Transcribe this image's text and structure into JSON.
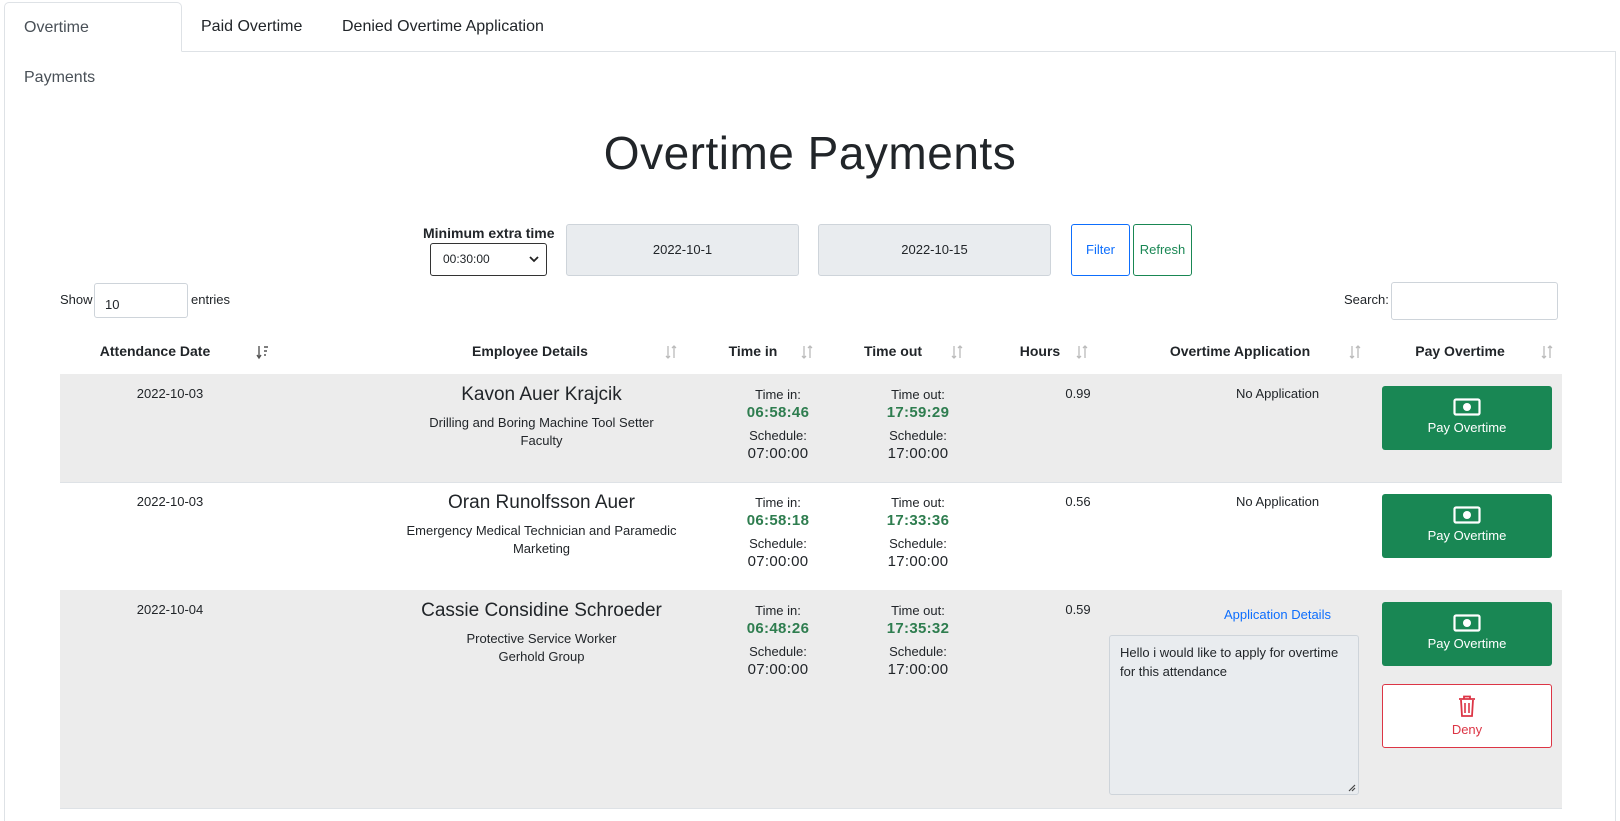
{
  "tabs": [
    {
      "label": "Overtime Payments"
    },
    {
      "label": "Paid Overtime"
    },
    {
      "label": "Denied Overtime Application"
    }
  ],
  "page_title": "Overtime Payments",
  "filters": {
    "min_label": "Minimum extra time",
    "min_value": "00:30:00",
    "date_from": "2022-10-1",
    "date_to": "2022-10-15",
    "filter_label": "Filter",
    "refresh_label": "Refresh"
  },
  "table_controls": {
    "show_label": "Show",
    "show_value": "10",
    "entries_label": "entries",
    "search_label": "Search:"
  },
  "columns": [
    "Attendance Date",
    "Employee Details",
    "Time in",
    "Time out",
    "Hours",
    "Overtime Application",
    "Pay Overtime"
  ],
  "labels": {
    "time_in": "Time in:",
    "time_out": "Time out:",
    "schedule": "Schedule:",
    "pay": "Pay Overtime",
    "deny": "Deny",
    "app_details": "Application Details"
  },
  "rows": [
    {
      "date": "2022-10-03",
      "name": "Kavon Auer Krajcik",
      "position": "Drilling and Boring Machine Tool Setter",
      "department": "Faculty",
      "time_in": "06:58:46",
      "sched_in": "07:00:00",
      "time_out": "17:59:29",
      "sched_out": "17:00:00",
      "hours": "0.99",
      "application": "No Application"
    },
    {
      "date": "2022-10-03",
      "name": "Oran Runolfsson Auer",
      "position": "Emergency Medical Technician and Paramedic",
      "department": "Marketing",
      "time_in": "06:58:18",
      "sched_in": "07:00:00",
      "time_out": "17:33:36",
      "sched_out": "17:00:00",
      "hours": "0.56",
      "application": "No Application"
    },
    {
      "date": "2022-10-04",
      "name": "Cassie Considine Schroeder",
      "position": "Protective Service Worker",
      "department": "Gerhold Group",
      "time_in": "06:48:26",
      "sched_in": "07:00:00",
      "time_out": "17:35:32",
      "sched_out": "17:00:00",
      "hours": "0.59",
      "application_text": "Hello i would like to apply for overtime for this attendance"
    }
  ],
  "colors": {
    "success": "#198754",
    "danger": "#dc3545",
    "primary": "#0d6efd",
    "time_green": "#2e7d4f"
  }
}
